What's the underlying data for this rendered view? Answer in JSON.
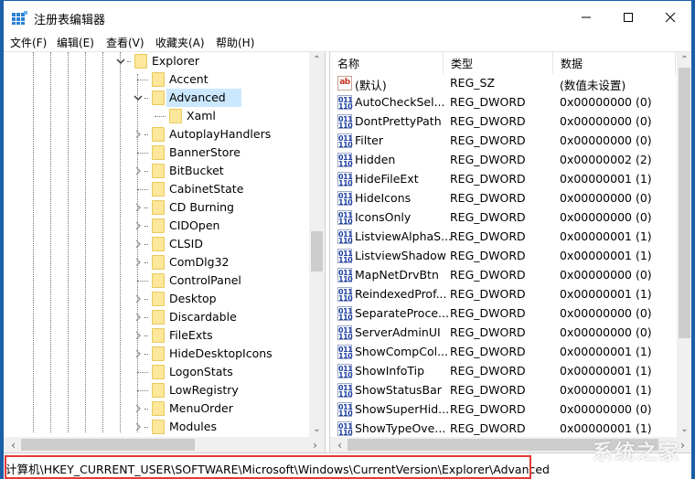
{
  "window": {
    "title": "注册表编辑器",
    "controls": {
      "minimize": "minimize-icon",
      "maximize": "maximize-icon",
      "close": "close-icon"
    }
  },
  "menu": [
    {
      "label": "文件(F)"
    },
    {
      "label": "编辑(E)"
    },
    {
      "label": "查看(V)"
    },
    {
      "label": "收藏夹(A)"
    },
    {
      "label": "帮助(H)"
    }
  ],
  "tree": {
    "items": [
      {
        "label": "Explorer",
        "expander": "expanded",
        "level": 0
      },
      {
        "label": "Accent",
        "expander": "none",
        "level": 1
      },
      {
        "label": "Advanced",
        "expander": "expanded",
        "level": 1,
        "selected": true
      },
      {
        "label": "Xaml",
        "expander": "none",
        "level": 2
      },
      {
        "label": "AutoplayHandlers",
        "expander": "collapsed",
        "level": 1
      },
      {
        "label": "BannerStore",
        "expander": "none",
        "level": 1
      },
      {
        "label": "BitBucket",
        "expander": "collapsed",
        "level": 1
      },
      {
        "label": "CabinetState",
        "expander": "none",
        "level": 1
      },
      {
        "label": "CD Burning",
        "expander": "collapsed",
        "level": 1
      },
      {
        "label": "CIDOpen",
        "expander": "collapsed",
        "level": 1
      },
      {
        "label": "CLSID",
        "expander": "collapsed",
        "level": 1
      },
      {
        "label": "ComDlg32",
        "expander": "collapsed",
        "level": 1
      },
      {
        "label": "ControlPanel",
        "expander": "none",
        "level": 1
      },
      {
        "label": "Desktop",
        "expander": "collapsed",
        "level": 1
      },
      {
        "label": "Discardable",
        "expander": "collapsed",
        "level": 1
      },
      {
        "label": "FileExts",
        "expander": "collapsed",
        "level": 1
      },
      {
        "label": "HideDesktopIcons",
        "expander": "collapsed",
        "level": 1
      },
      {
        "label": "LogonStats",
        "expander": "none",
        "level": 1
      },
      {
        "label": "LowRegistry",
        "expander": "none",
        "level": 1
      },
      {
        "label": "MenuOrder",
        "expander": "collapsed",
        "level": 1
      },
      {
        "label": "Modules",
        "expander": "collapsed",
        "level": 1
      }
    ]
  },
  "list": {
    "columns": [
      "名称",
      "类型",
      "数据"
    ],
    "rows": [
      {
        "icon": "string-value-icon",
        "name": "(默认)",
        "type": "REG_SZ",
        "data": "(数值未设置)"
      },
      {
        "icon": "dword-value-icon",
        "name": "AutoCheckSel...",
        "type": "REG_DWORD",
        "data": "0x00000000 (0)"
      },
      {
        "icon": "dword-value-icon",
        "name": "DontPrettyPath",
        "type": "REG_DWORD",
        "data": "0x00000000 (0)"
      },
      {
        "icon": "dword-value-icon",
        "name": "Filter",
        "type": "REG_DWORD",
        "data": "0x00000000 (0)"
      },
      {
        "icon": "dword-value-icon",
        "name": "Hidden",
        "type": "REG_DWORD",
        "data": "0x00000002 (2)"
      },
      {
        "icon": "dword-value-icon",
        "name": "HideFileExt",
        "type": "REG_DWORD",
        "data": "0x00000001 (1)"
      },
      {
        "icon": "dword-value-icon",
        "name": "HideIcons",
        "type": "REG_DWORD",
        "data": "0x00000000 (0)"
      },
      {
        "icon": "dword-value-icon",
        "name": "IconsOnly",
        "type": "REG_DWORD",
        "data": "0x00000000 (0)"
      },
      {
        "icon": "dword-value-icon",
        "name": "ListviewAlphaS...",
        "type": "REG_DWORD",
        "data": "0x00000001 (1)"
      },
      {
        "icon": "dword-value-icon",
        "name": "ListviewShadow",
        "type": "REG_DWORD",
        "data": "0x00000001 (1)"
      },
      {
        "icon": "dword-value-icon",
        "name": "MapNetDrvBtn",
        "type": "REG_DWORD",
        "data": "0x00000000 (0)"
      },
      {
        "icon": "dword-value-icon",
        "name": "ReindexedProf...",
        "type": "REG_DWORD",
        "data": "0x00000001 (1)"
      },
      {
        "icon": "dword-value-icon",
        "name": "SeparateProce...",
        "type": "REG_DWORD",
        "data": "0x00000000 (0)"
      },
      {
        "icon": "dword-value-icon",
        "name": "ServerAdminUI",
        "type": "REG_DWORD",
        "data": "0x00000000 (0)"
      },
      {
        "icon": "dword-value-icon",
        "name": "ShowCompCol...",
        "type": "REG_DWORD",
        "data": "0x00000001 (1)"
      },
      {
        "icon": "dword-value-icon",
        "name": "ShowInfoTip",
        "type": "REG_DWORD",
        "data": "0x00000001 (1)"
      },
      {
        "icon": "dword-value-icon",
        "name": "ShowStatusBar",
        "type": "REG_DWORD",
        "data": "0x00000001 (1)"
      },
      {
        "icon": "dword-value-icon",
        "name": "ShowSuperHid...",
        "type": "REG_DWORD",
        "data": "0x00000000 (0)"
      },
      {
        "icon": "dword-value-icon",
        "name": "ShowTypeOve...",
        "type": "REG_DWORD",
        "data": "0x00000001 (1)"
      }
    ],
    "icon_text": {
      "sz": "ab",
      "dword": "011\n110"
    }
  },
  "status": {
    "path": "计算机\\HKEY_CURRENT_USER\\SOFTWARE\\Microsoft\\Windows\\CurrentVersion\\Explorer\\Advanced"
  },
  "watermark": "系统之家",
  "colors": {
    "frame": "#1a5fa8",
    "selection": "#cce8ff",
    "highlight_box": "#e53935",
    "folder": "#fce79a"
  }
}
